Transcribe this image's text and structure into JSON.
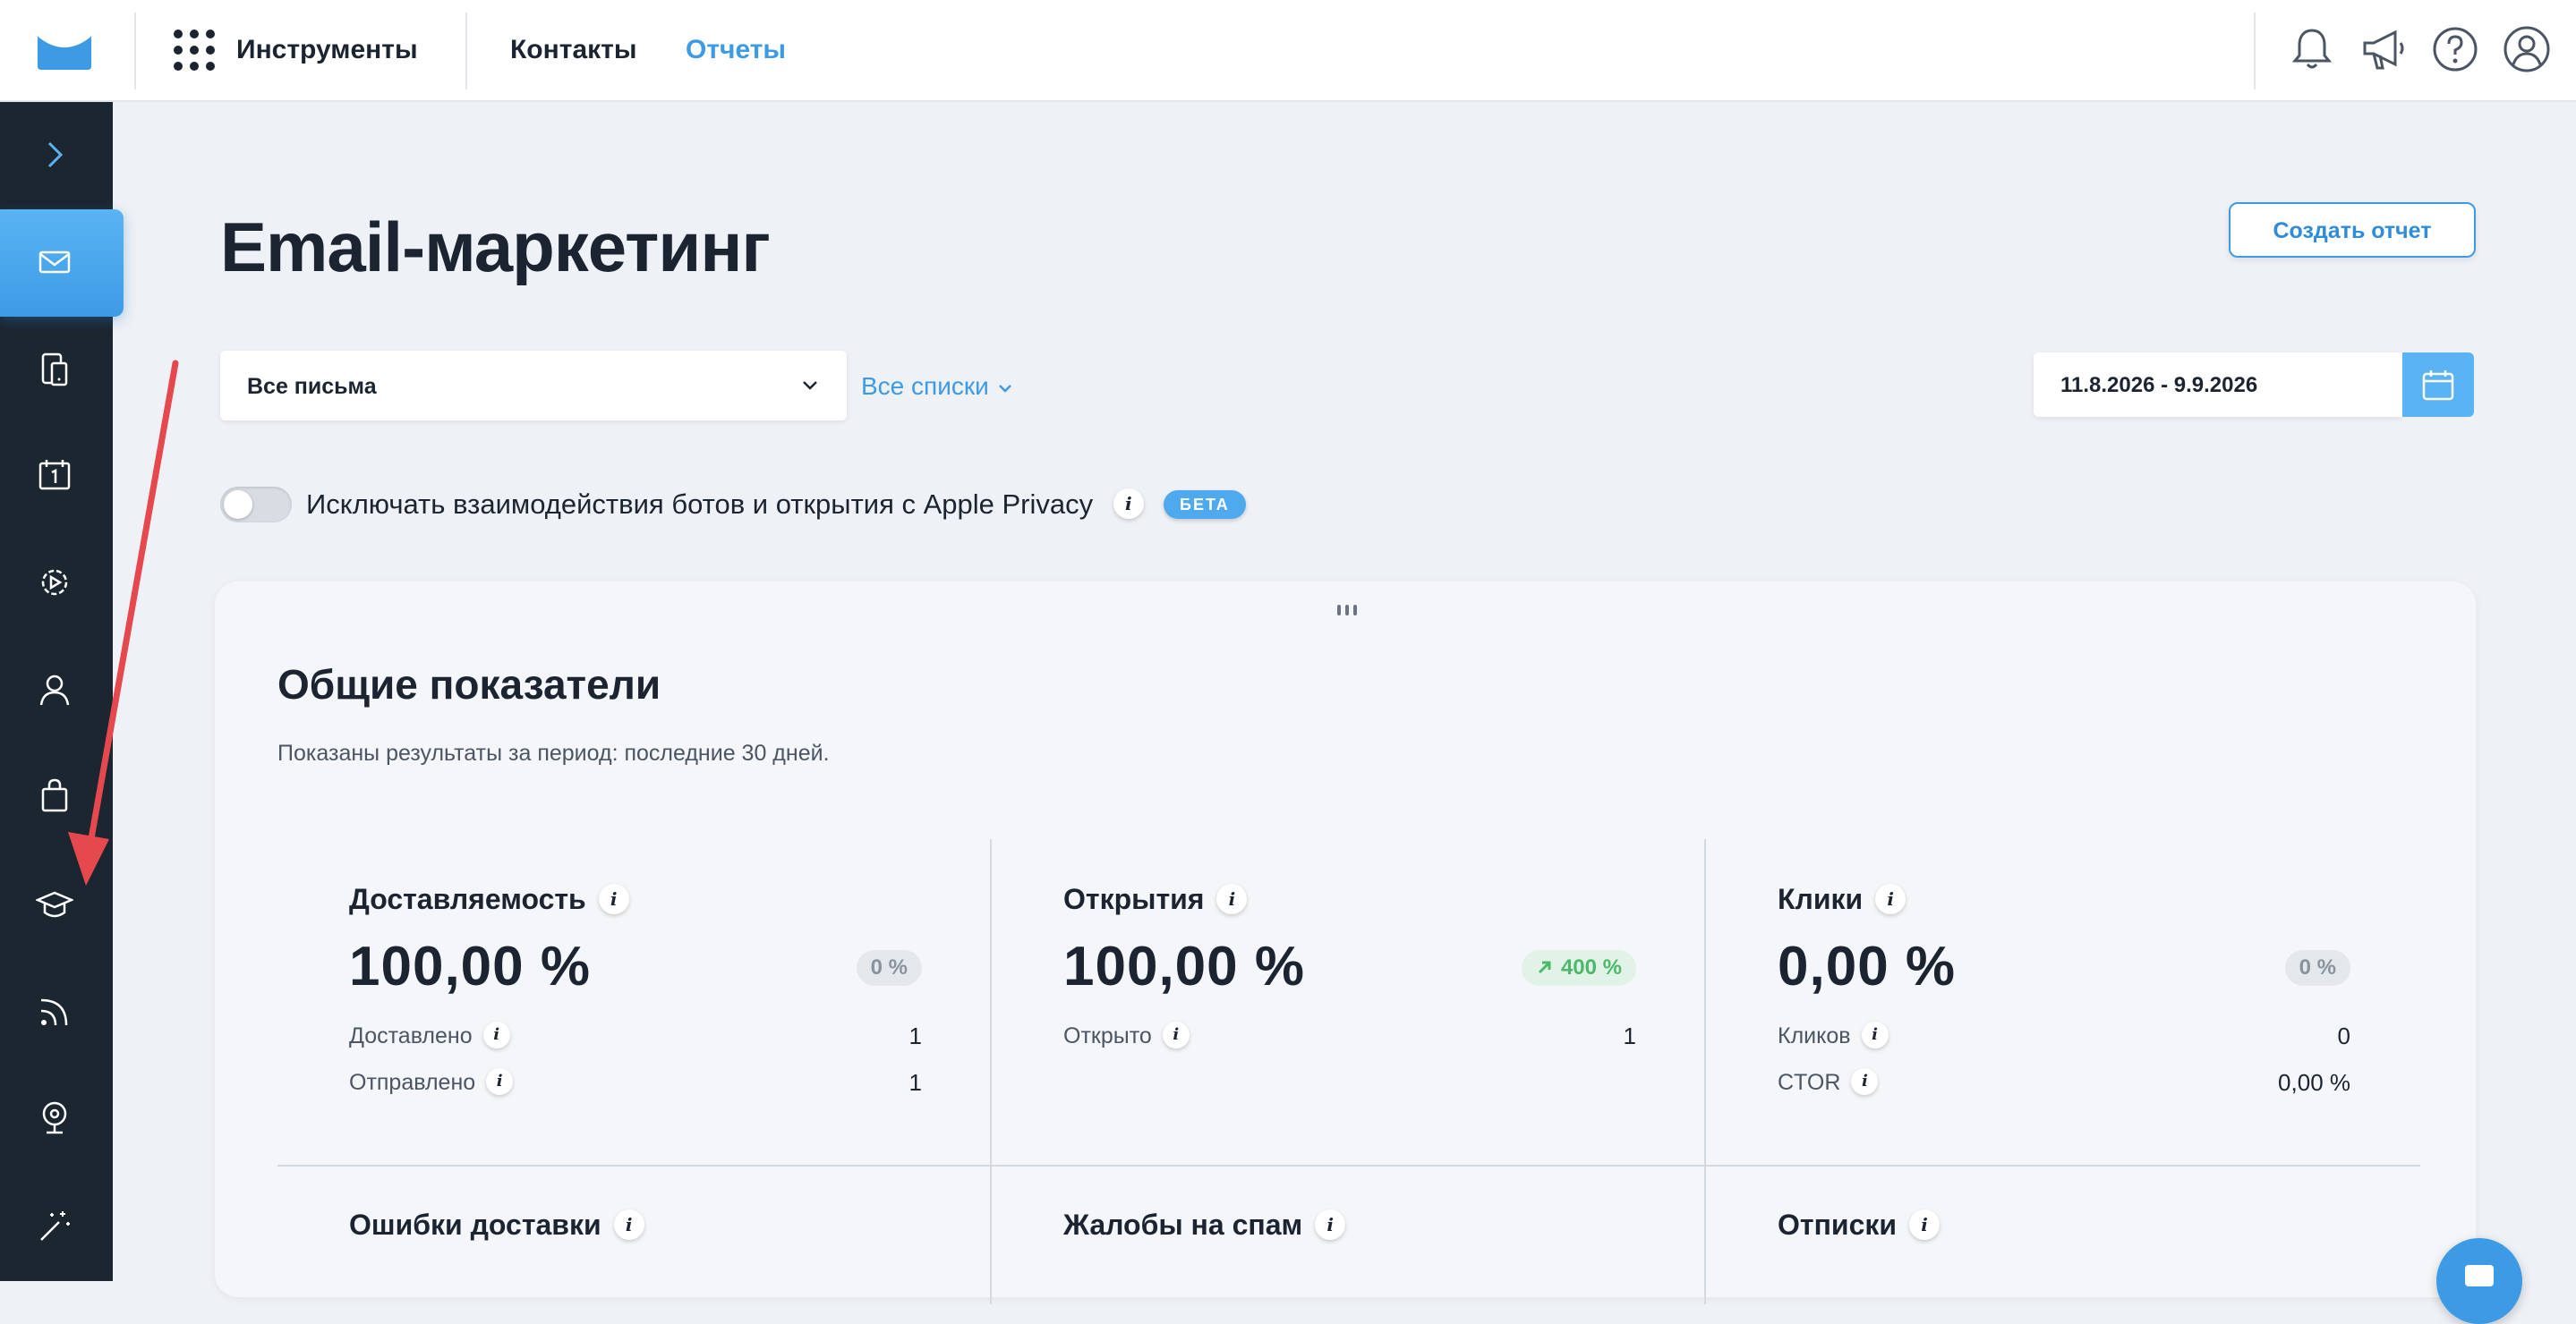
{
  "topbar": {
    "tools_label": "Инструменты",
    "nav": [
      {
        "label": "Контакты",
        "active": false
      },
      {
        "label": "Отчеты",
        "active": true
      }
    ],
    "icons": [
      "bell-icon",
      "megaphone-icon",
      "help-icon",
      "account-icon"
    ]
  },
  "sidebar": {
    "items": [
      "expand-chevron-icon",
      "email-icon",
      "mobile-forms-icon",
      "calendar-icon",
      "automation-gear-icon",
      "contacts-user-icon",
      "shop-bag-icon",
      "academy-graduation-icon",
      "rss-icon",
      "webinar-icon",
      "magic-wand-icon"
    ],
    "active": "email-icon"
  },
  "page": {
    "title": "Email-маркетинг",
    "create_button": "Создать отчет"
  },
  "filters": {
    "messages_select": "Все письма",
    "lists_link": "Все списки",
    "date_range": "11.8.2026 - 9.9.2026",
    "toggle_label": "Исключать взаимодействия ботов и открытия с Apple Privacy",
    "toggle_on": false,
    "beta_badge": "БЕТА"
  },
  "overview": {
    "title": "Общие показатели",
    "subtitle": "Показаны результаты за период: последние 30 дней.",
    "metrics": [
      {
        "title": "Доставляемость",
        "value": "100,00 %",
        "badge": "0 %",
        "rows": [
          {
            "label": "Доставлено",
            "value": "1"
          },
          {
            "label": "Отправлено",
            "value": "1"
          }
        ]
      },
      {
        "title": "Открытия",
        "value": "100,00 %",
        "badge": "400 %",
        "badge_trend": "up",
        "rows": [
          {
            "label": "Открыто",
            "value": "1"
          }
        ]
      },
      {
        "title": "Клики",
        "value": "0,00 %",
        "badge": "0 %",
        "rows": [
          {
            "label": "Кликов",
            "value": "0"
          },
          {
            "label": "CTOR",
            "value": "0,00 %"
          }
        ]
      }
    ],
    "second_row": [
      "Ошибки доставки",
      "Жалобы на спам",
      "Отписки"
    ]
  },
  "colors": {
    "accent": "#3d9be6",
    "sidebar_bg": "#1c2631",
    "page_bg": "#eef1f5",
    "positive": "#4cb96a",
    "annotation_arrow": "#e5484d"
  }
}
